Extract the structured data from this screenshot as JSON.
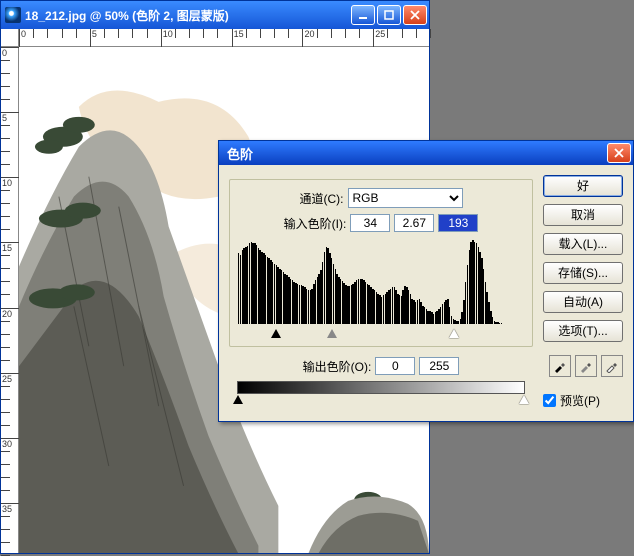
{
  "docwin": {
    "title": "18_212.jpg @ 50% (色阶 2, 图层蒙版)",
    "ruler_labels_h": [
      "0",
      "5",
      "10",
      "15",
      "20",
      "25"
    ],
    "ruler_labels_v": [
      "0",
      "5",
      "10",
      "15",
      "20",
      "25",
      "30",
      "35"
    ]
  },
  "dialog": {
    "title": "色阶",
    "channel_label": "通道(C):",
    "channel_value": "RGB",
    "input_levels_label": "输入色阶(I):",
    "input_black": "34",
    "input_gamma": "2.67",
    "input_white": "193",
    "output_levels_label": "输出色阶(O):",
    "output_black": "0",
    "output_white": "255",
    "histogram": [
      84,
      82,
      88,
      90,
      92,
      93,
      96,
      98,
      97,
      96,
      94,
      90,
      88,
      86,
      84,
      82,
      80,
      78,
      76,
      74,
      72,
      70,
      68,
      66,
      64,
      62,
      60,
      58,
      56,
      54,
      52,
      50,
      49,
      48,
      47,
      46,
      45,
      44,
      42,
      40,
      40,
      42,
      48,
      52,
      56,
      60,
      64,
      74,
      86,
      92,
      90,
      84,
      78,
      72,
      66,
      60,
      56,
      53,
      51,
      49,
      47,
      45,
      45,
      46,
      48,
      50,
      52,
      54,
      54,
      53,
      52,
      50,
      48,
      46,
      44,
      42,
      40,
      38,
      36,
      34,
      32,
      34,
      36,
      38,
      40,
      42,
      44,
      44,
      40,
      36,
      34,
      33,
      40,
      45,
      44,
      40,
      36,
      30,
      28,
      26,
      28,
      30,
      26,
      22,
      20,
      18,
      16,
      16,
      14,
      12,
      14,
      16,
      18,
      20,
      24,
      26,
      28,
      30,
      20,
      10,
      6,
      5,
      4,
      4,
      6,
      14,
      28,
      50,
      70,
      88,
      98,
      100,
      98,
      96,
      92,
      86,
      78,
      66,
      50,
      38,
      26,
      16,
      8,
      4,
      2,
      2,
      1,
      1,
      0,
      0,
      0,
      0,
      0,
      0,
      0,
      0,
      0,
      0,
      0,
      0
    ]
  },
  "buttons": {
    "ok": "好",
    "cancel": "取消",
    "load": "载入(L)...",
    "save": "存储(S)...",
    "auto": "自动(A)",
    "options": "选项(T)..."
  },
  "preview": {
    "label": "预览(P)"
  }
}
